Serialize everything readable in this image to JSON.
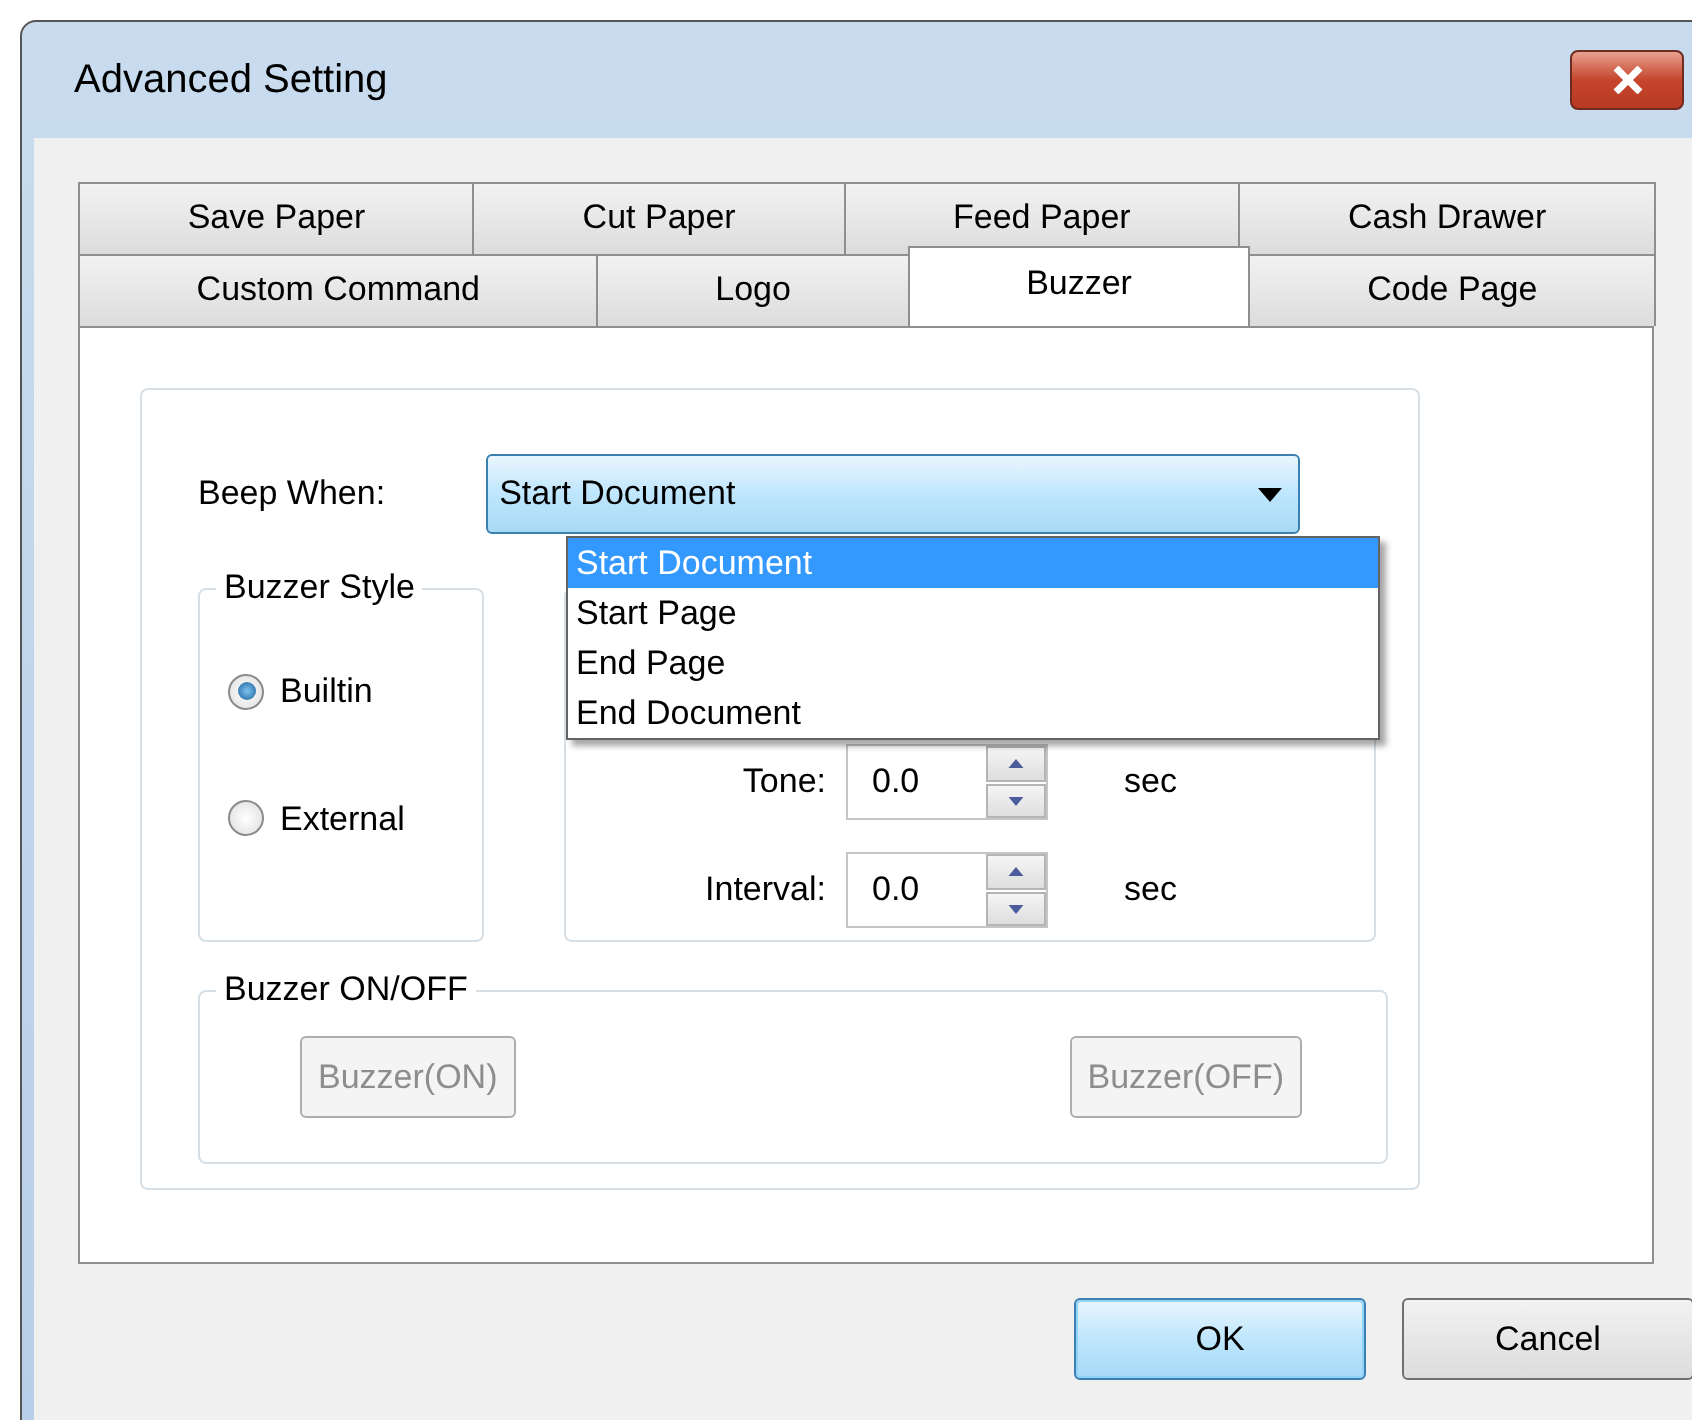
{
  "window": {
    "title": "Advanced Setting"
  },
  "tab_rows": [
    [
      {
        "label": "Save Paper",
        "selected": false
      },
      {
        "label": "Cut Paper",
        "selected": false
      },
      {
        "label": "Feed Paper",
        "selected": false
      },
      {
        "label": "Cash Drawer",
        "selected": false
      }
    ],
    [
      {
        "label": "Custom Command",
        "selected": false
      },
      {
        "label": "Logo",
        "selected": false
      },
      {
        "label": "Buzzer",
        "selected": true
      },
      {
        "label": "Code Page",
        "selected": false
      }
    ]
  ],
  "beep_when": {
    "label": "Beep When:",
    "value": "Start Document",
    "expanded": true,
    "options": [
      {
        "label": "Start Document",
        "selected": true
      },
      {
        "label": "Start Page",
        "selected": false
      },
      {
        "label": "End Page",
        "selected": false
      },
      {
        "label": "End Document",
        "selected": false
      }
    ]
  },
  "buzzer_style": {
    "title": "Buzzer Style",
    "options": [
      {
        "label": "Builtin",
        "selected": true
      },
      {
        "label": "External",
        "selected": false
      }
    ]
  },
  "timing": [
    {
      "label": "Tone:",
      "value": "0.0",
      "unit": "sec"
    },
    {
      "label": "Interval:",
      "value": "0.0",
      "unit": "sec"
    }
  ],
  "buzzer_on_off": {
    "title": "Buzzer ON/OFF",
    "buttons": [
      {
        "label": "Buzzer(ON)",
        "disabled": true
      },
      {
        "label": "Buzzer(OFF)",
        "disabled": true
      }
    ]
  },
  "buttons": [
    {
      "label": "OK",
      "default": true
    },
    {
      "label": "Cancel",
      "default": false
    }
  ]
}
